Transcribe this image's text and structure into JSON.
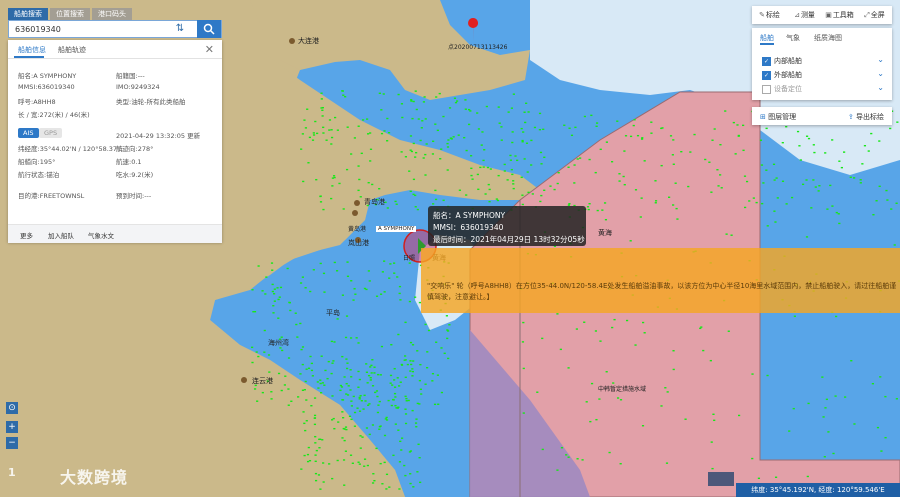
{
  "search": {
    "tabs": [
      "船舶搜索",
      "位置搜索",
      "港口码头"
    ],
    "value": "636019340"
  },
  "panel": {
    "tabs": [
      "船舶信息",
      "船舶轨迹"
    ],
    "name": "船名:A SYMPHONY",
    "flag": "船籍国:---",
    "mmsi": "MMSI:636019340",
    "imo": "IMO:9249324",
    "callsign": "呼号:A8HH8",
    "type": "类型:油轮-所有此类船舶",
    "size": "长 / 宽:272(米) / 46(米)",
    "source_ais": "AIS",
    "source_gps": "GPS",
    "updated": "2021-04-29 13:32:05 更新",
    "position": "纬经度:35°44.02'N / 120°58.37'E",
    "track_direction": "航迹向:278°",
    "heading": "船艏向:195°",
    "speed": "航速:0.1",
    "nav_status": "航行状态:锚泊",
    "draft": "吃水:9.2(米)",
    "destination": "目的港:FREETOWNSL",
    "eta": "预到时间:---",
    "footer": [
      "更多",
      "加入船队",
      "气象水文"
    ]
  },
  "toolbar": {
    "items": [
      "标绘",
      "测量",
      "工具箱",
      "全屏"
    ]
  },
  "layers": {
    "tabs": [
      "船舶",
      "气象",
      "纸质海图"
    ],
    "rows": [
      {
        "label": "内部船舶",
        "checked": true
      },
      {
        "label": "外部船舶",
        "checked": true
      },
      {
        "label": "设备定位",
        "checked": false
      }
    ],
    "manage": "图层管理",
    "export": "导出标绘"
  },
  "popup": {
    "name": "船名：A SYMPHONY",
    "mmsi": "MMSI：636019340",
    "time": "最后时间：2021年04月29日 13时32分05秒"
  },
  "warning": {
    "text": "\"交响乐\" 轮（呼号A8HH8）在方位35-44.0N/120-58.4E处发生船舶溢油事故，以该方位为中心半径10海里水域范围内，禁止船舶驶入，请过往船舶谨慎驾驶，注意避让。】"
  },
  "map": {
    "labels": {
      "dalian": "大连港",
      "marker_id": "点20200713113426",
      "qingdao": "青岛港",
      "huangdao": "黄岛港",
      "yellow_sea": "黄海",
      "lanshan": "岚山港",
      "lianyungang": "连云港",
      "haizhou": "海州湾",
      "pingdao": "平岛",
      "boundary": "中韩暂定措施水域",
      "ship_label": "A SYMPHONY",
      "wreck_label": "沉船区",
      "rizhao": "日照"
    },
    "watermark": "大数跨境",
    "watermark_num": "1",
    "coords": "纬度: 35°45.192'N, 经度: 120°59.546'E",
    "colors": {
      "land": "#cbb98a",
      "sea": "#58a5e8",
      "shallow": "#d8e9f6",
      "zone": "#e2a0a8",
      "ships": "#17e817"
    }
  }
}
